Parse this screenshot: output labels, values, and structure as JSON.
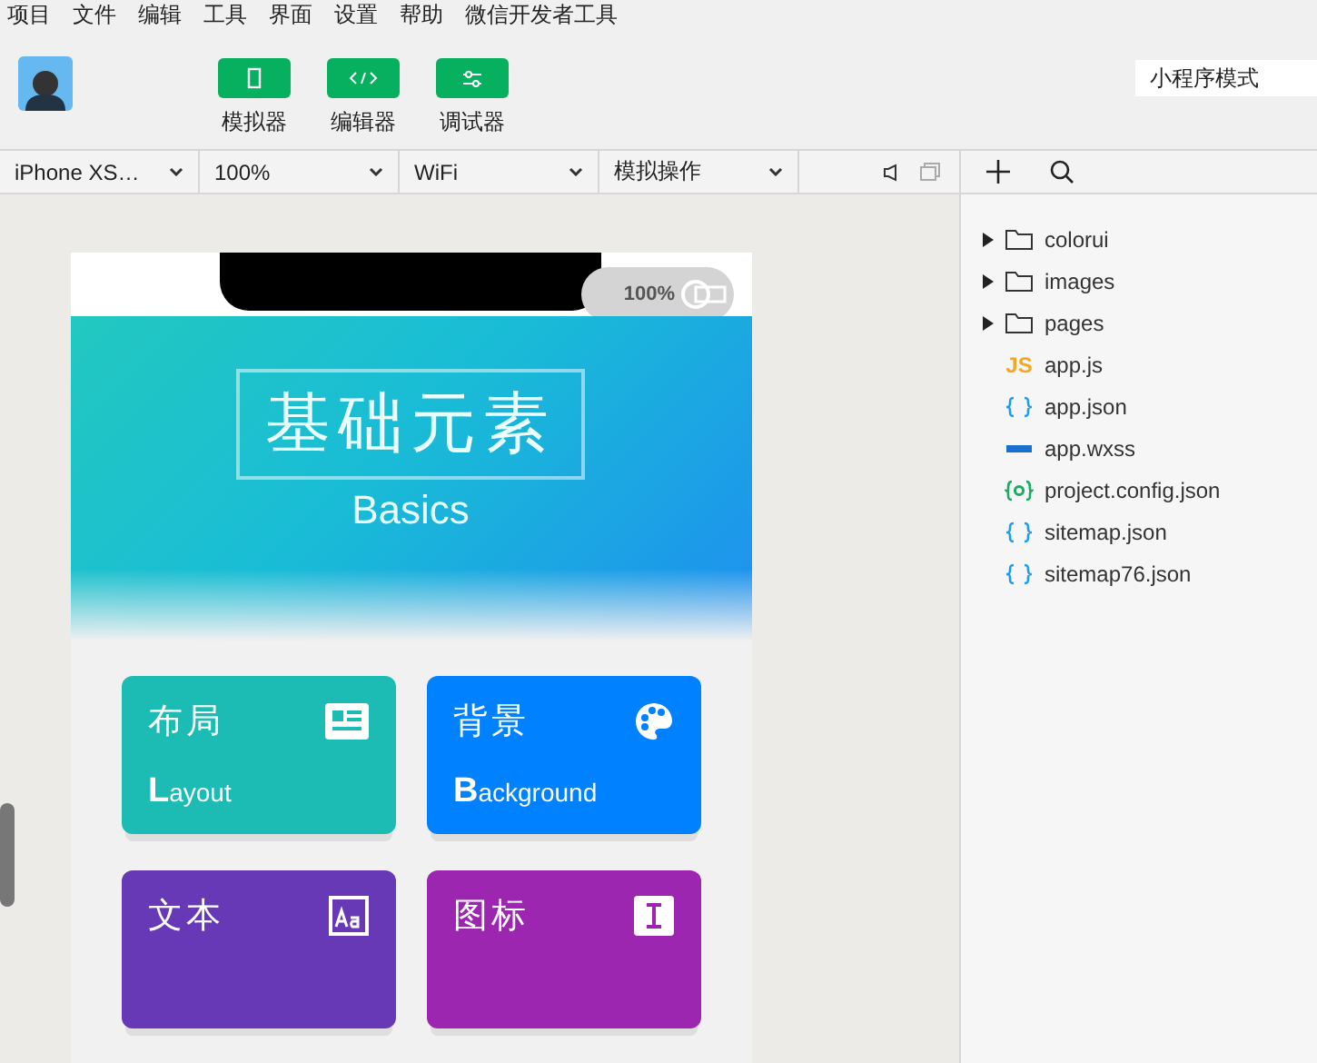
{
  "menu": [
    "项目",
    "文件",
    "编辑",
    "工具",
    "界面",
    "设置",
    "帮助",
    "微信开发者工具"
  ],
  "toolbar": {
    "buttons": [
      {
        "label": "模拟器",
        "kind": "phone"
      },
      {
        "label": "编辑器",
        "kind": "code"
      },
      {
        "label": "调试器",
        "kind": "debug"
      }
    ],
    "mode": {
      "value": "小程序模式"
    }
  },
  "device_bar": {
    "selects": [
      "iPhone XS…",
      "100%",
      "WiFi",
      "模拟操作"
    ]
  },
  "simulator": {
    "status": {
      "battery": "100%"
    },
    "banner": {
      "title": "基础元素",
      "subtitle": "Basics"
    },
    "cards": [
      {
        "title": "布局",
        "subtitle": "Layout",
        "color": "#1cbbb4",
        "kind": "layout"
      },
      {
        "title": "背景",
        "subtitle": "Background",
        "color": "#0081ff",
        "kind": "palette"
      },
      {
        "title": "文本",
        "color": "#6739b6",
        "kind": "text"
      },
      {
        "title": "图标",
        "color": "#9c26b0",
        "kind": "cursor"
      }
    ]
  },
  "file_tree": {
    "items": [
      {
        "name": "colorui",
        "kind": "folder",
        "expanded": false
      },
      {
        "name": "images",
        "kind": "folder",
        "expanded": false
      },
      {
        "name": "pages",
        "kind": "folder",
        "expanded": false
      },
      {
        "name": "app.js",
        "kind": "js",
        "badge": "JS"
      },
      {
        "name": "app.json",
        "kind": "json"
      },
      {
        "name": "app.wxss",
        "kind": "wxss"
      },
      {
        "name": "project.config.json",
        "kind": "config"
      },
      {
        "name": "sitemap.json",
        "kind": "json"
      },
      {
        "name": "sitemap76.json",
        "kind": "json"
      }
    ]
  }
}
